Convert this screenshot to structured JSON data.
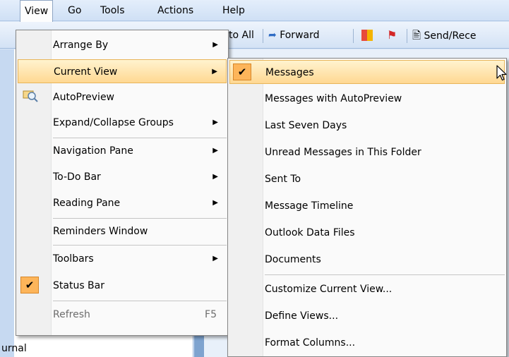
{
  "menubar": {
    "items": [
      {
        "label": "View",
        "underline": "V"
      },
      {
        "label": "Go",
        "underline": "G"
      },
      {
        "label": "Tools",
        "underline": "T"
      },
      {
        "label": "Actions",
        "underline": "A"
      },
      {
        "label": "Help",
        "underline": "H"
      }
    ]
  },
  "toolbar": {
    "reply_all_label": "to All",
    "forward_label": "Forward",
    "send_receive_label": "Send/Rece"
  },
  "leftpane": {
    "partial_label": "urnal"
  },
  "view_menu": {
    "items": [
      {
        "label": "Arrange By",
        "submenu": true
      },
      {
        "label": "Current View",
        "submenu": true,
        "highlighted": true
      },
      {
        "label": "AutoPreview",
        "icon": "autopreview-icon"
      },
      {
        "label": "Expand/Collapse Groups",
        "submenu": true
      },
      {
        "label": "Navigation Pane",
        "submenu": true
      },
      {
        "label": "To-Do Bar",
        "submenu": true
      },
      {
        "label": "Reading Pane",
        "submenu": true
      },
      {
        "label": "Reminders Window"
      },
      {
        "label": "Toolbars",
        "submenu": true
      },
      {
        "label": "Status Bar",
        "checked": true
      },
      {
        "label": "Refresh",
        "shortcut": "F5",
        "disabled": true
      }
    ]
  },
  "current_view_menu": {
    "items": [
      {
        "label": "Messages",
        "checked": true,
        "highlighted": true
      },
      {
        "label": "Messages with AutoPreview"
      },
      {
        "label": "Last Seven Days"
      },
      {
        "label": "Unread Messages in This Folder"
      },
      {
        "label": "Sent To"
      },
      {
        "label": "Message Timeline"
      },
      {
        "label": "Outlook Data Files"
      },
      {
        "label": "Documents"
      },
      {
        "label": "Customize Current View..."
      },
      {
        "label": "Define Views..."
      },
      {
        "label": "Format Columns..."
      }
    ]
  },
  "colors": {
    "highlight": "#ffd892",
    "check_bg": "#fdb55a",
    "menubar": "#cfe0f5"
  }
}
